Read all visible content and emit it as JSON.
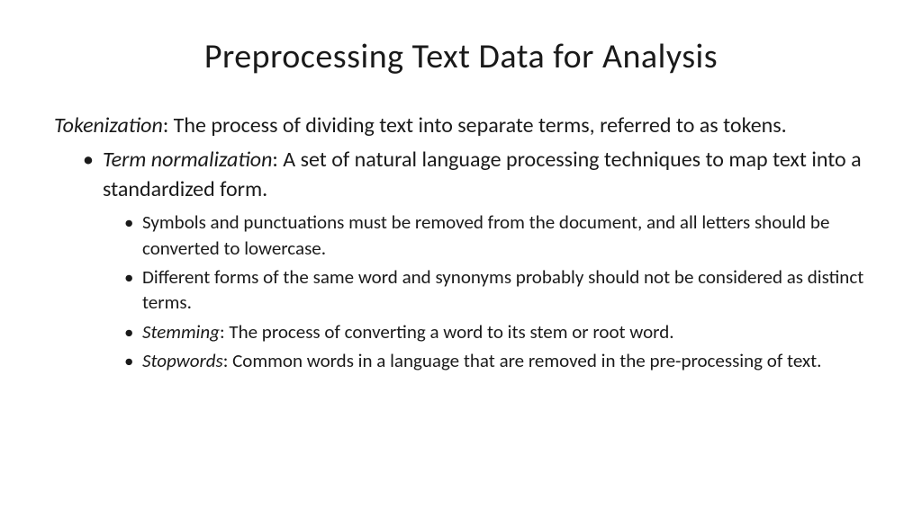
{
  "title": "Preprocessing Text Data for Analysis",
  "tokenization": {
    "term": "Tokenization",
    "definition": ": The process of dividing text into separate terms, referred to as tokens."
  },
  "term_normalization": {
    "term": "Term normalization",
    "definition": ": A set of natural language processing techniques to map text into a standardized form."
  },
  "sub_items": {
    "symbols": "Symbols and punctuations must be removed from the document, and all letters should be converted to lowercase.",
    "different_forms": "Different forms of the same word and synonyms probably should not be considered as distinct terms.",
    "stemming_term": "Stemming",
    "stemming_def": ": The process of converting a word to its stem or root word.",
    "stopwords_term": "Stopwords",
    "stopwords_def": ": Common words in a language that are removed in the pre-processing of text."
  }
}
